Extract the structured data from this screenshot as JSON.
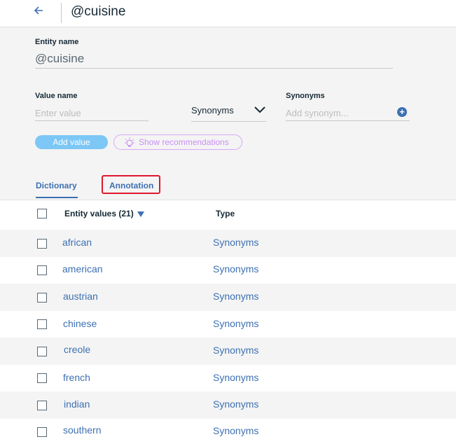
{
  "header": {
    "title": "@cuisine"
  },
  "form": {
    "entity_name_label": "Entity name",
    "entity_name_value": "@cuisine",
    "value_name_label": "Value name",
    "value_placeholder": "Enter value",
    "type_select_value": "Synonyms",
    "synonyms_label": "Synonyms",
    "synonyms_placeholder": "Add synonym...",
    "add_value_label": "Add value",
    "show_recommendations_label": "Show recommendations"
  },
  "tabs": [
    {
      "label": "Dictionary",
      "active": true
    },
    {
      "label": "Annotation",
      "active": false,
      "highlighted": true
    }
  ],
  "table": {
    "columns": [
      {
        "label": "Entity values (21)"
      },
      {
        "label": "Type"
      }
    ],
    "rows": [
      {
        "name": "african",
        "type": "Synonyms"
      },
      {
        "name": "american",
        "type": "Synonyms"
      },
      {
        "name": "austrian",
        "type": "Synonyms"
      },
      {
        "name": "chinese",
        "type": "Synonyms"
      },
      {
        "name": "creole",
        "type": "Synonyms"
      },
      {
        "name": "french",
        "type": "Synonyms"
      },
      {
        "name": "indian",
        "type": "Synonyms"
      },
      {
        "name": "southern",
        "type": "Synonyms"
      }
    ]
  },
  "colors": {
    "accent": "#3d70b2",
    "add_button": "#7cc7f5",
    "recommendations": "#c98ff2",
    "highlight": "#e0182d"
  },
  "icons": {
    "back": "arrow-left-icon",
    "dropdown": "chevron-down-icon",
    "add": "plus-circle-icon",
    "recommend": "lightbulb-icon",
    "sort": "sort-desc-icon"
  }
}
